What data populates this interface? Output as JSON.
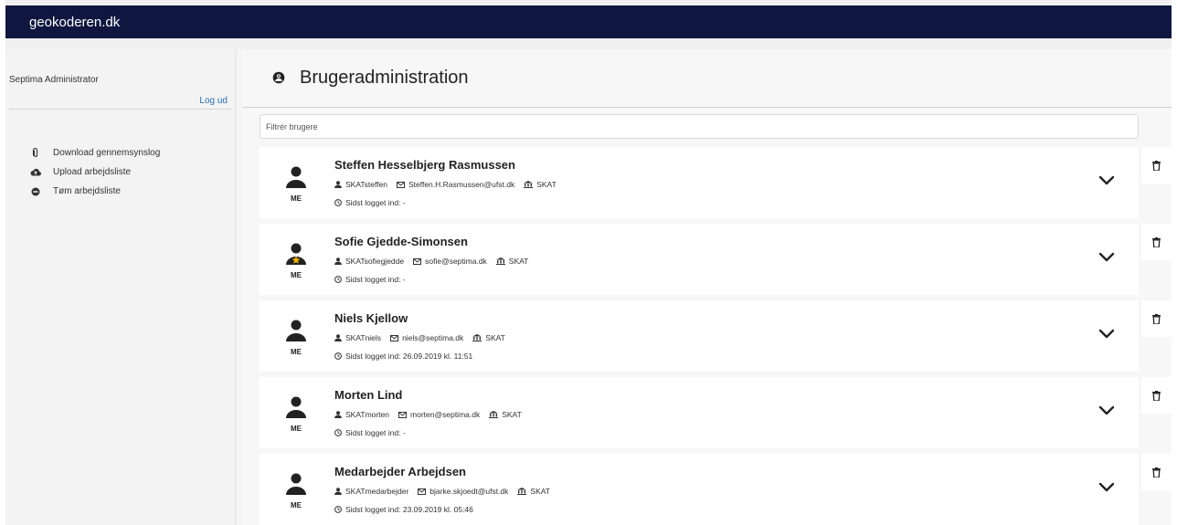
{
  "app": {
    "title": "geokoderen.dk"
  },
  "sidebar": {
    "user_name": "Septima Administrator",
    "logout_label": "Log ud",
    "menu": [
      {
        "label": "Download gennemsynslog",
        "icon": "paperclip-icon"
      },
      {
        "label": "Upload arbejdsliste",
        "icon": "cloud-upload-icon"
      },
      {
        "label": "Tøm arbejdsliste",
        "icon": "minus-circle-icon"
      }
    ]
  },
  "page": {
    "title": "Brugeradministration",
    "title_icon": "user-admin-icon",
    "filter_placeholder": "Filtrér brugere"
  },
  "users": [
    {
      "name": "Steffen Hesselbjerg Rasmussen",
      "initials": "ME",
      "username": "SKATsteffen",
      "email": "Steffen.H.Rasmussen@ufst.dk",
      "org": "SKAT",
      "last_login": "Sidst logget ind: -",
      "admin": false
    },
    {
      "name": "Sofie Gjedde-Simonsen",
      "initials": "ME",
      "username": "SKATsofiegjedde",
      "email": "sofie@septima.dk",
      "org": "SKAT",
      "last_login": "Sidst logget ind: -",
      "admin": true
    },
    {
      "name": "Niels Kjellow",
      "initials": "ME",
      "username": "SKATniels",
      "email": "niels@septima.dk",
      "org": "SKAT",
      "last_login": "Sidst logget ind: 26.09.2019 kl. 11:51",
      "admin": false
    },
    {
      "name": "Morten Lind",
      "initials": "ME",
      "username": "SKATmorten",
      "email": "morten@septima.dk",
      "org": "SKAT",
      "last_login": "Sidst logget ind: -",
      "admin": false
    },
    {
      "name": "Medarbejder Arbejdsen",
      "initials": "ME",
      "username": "SKATmedarbejder",
      "email": "bjarke.skjoedt@ufst.dk",
      "org": "SKAT",
      "last_login": "Sidst logget ind: 23.09.2019 kl. 05:46",
      "admin": false
    }
  ],
  "colors": {
    "topbar": "#0f1740",
    "link": "#2a6ebb",
    "admin_star": "#f0b400"
  }
}
